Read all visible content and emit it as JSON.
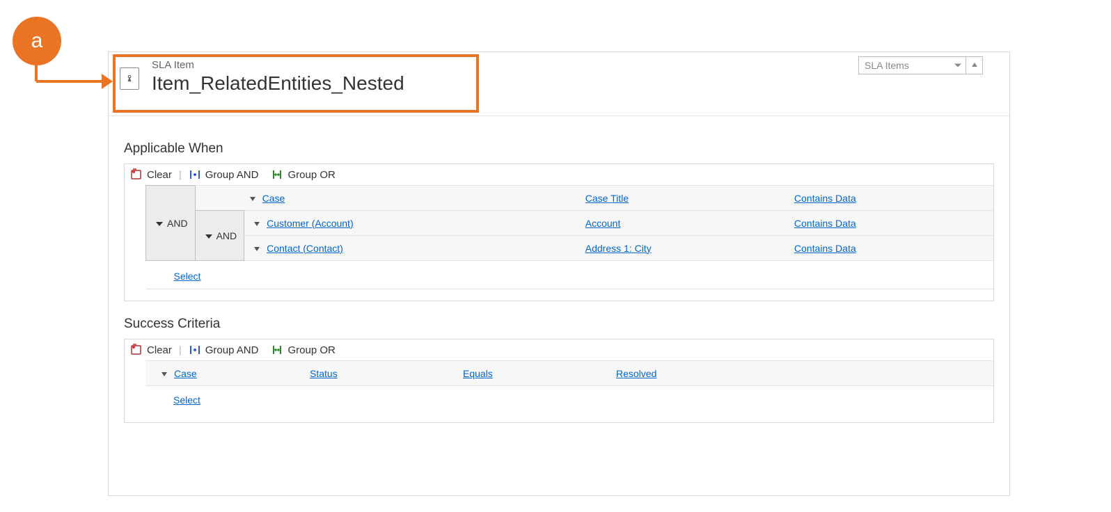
{
  "callout": {
    "letter": "a"
  },
  "header": {
    "entity_label": "SLA Item",
    "title": "Item_RelatedEntities_Nested",
    "nav_dropdown": "SLA Items"
  },
  "sections": {
    "applicable": {
      "title": "Applicable When",
      "toolbar": {
        "clear": "Clear",
        "group_and": "Group AND",
        "group_or": "Group OR"
      },
      "outer_op": "AND",
      "inner_op": "AND",
      "rows": [
        {
          "entity": "Case",
          "field": "Case Title",
          "operator": "Contains Data"
        },
        {
          "entity": "Customer (Account)",
          "field": "Account",
          "operator": "Contains Data"
        },
        {
          "entity": "Contact (Contact)",
          "field": "Address 1: City",
          "operator": "Contains Data"
        }
      ],
      "select": "Select"
    },
    "success": {
      "title": "Success Criteria",
      "toolbar": {
        "clear": "Clear",
        "group_and": "Group AND",
        "group_or": "Group OR"
      },
      "rows": [
        {
          "entity": "Case",
          "field": "Status",
          "operator": "Equals",
          "value": "Resolved"
        }
      ],
      "select": "Select"
    }
  }
}
